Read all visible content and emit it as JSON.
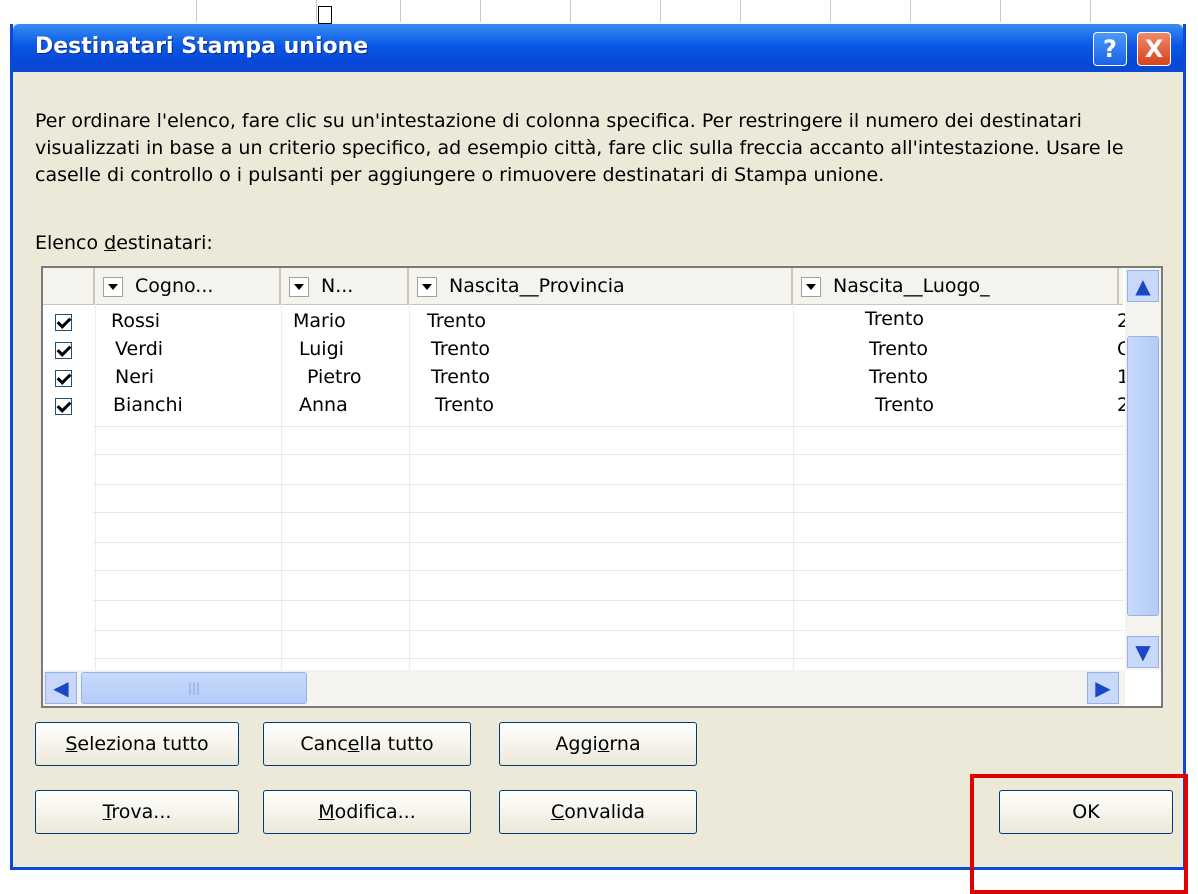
{
  "window": {
    "title": "Destinatari Stampa unione"
  },
  "title_buttons": {
    "help": "?",
    "close": "X"
  },
  "description": "Per ordinare l'elenco, fare clic su un'intestazione di colonna specifica. Per restringere il numero dei destinatari visualizzati in base a un criterio specifico, ad esempio città, fare clic sulla freccia accanto all'intestazione. Usare le caselle di controllo o i pulsanti per aggiungere o rimuovere destinatari di Stampa unione.",
  "list_label": {
    "before": "Elenco ",
    "accel": "d",
    "after": "estinatari:"
  },
  "columns": [
    "Cogno...",
    "N...",
    "Nascita__Provincia",
    "Nascita__Luogo_"
  ],
  "rows": [
    {
      "checked": true,
      "cognome": "Rossi",
      "nome": "Mario",
      "provincia": "Trento",
      "luogo": "Trento",
      "extra": "2"
    },
    {
      "checked": true,
      "cognome": "Verdi",
      "nome": "Luigi",
      "provincia": "Trento",
      "luogo": "Trento",
      "extra": "C"
    },
    {
      "checked": true,
      "cognome": "Neri",
      "nome": "Pietro",
      "provincia": "Trento",
      "luogo": "Trento",
      "extra": "1"
    },
    {
      "checked": true,
      "cognome": "Bianchi",
      "nome": "Anna",
      "provincia": "Trento",
      "luogo": "Trento",
      "extra": "2"
    }
  ],
  "buttons": {
    "select_all": {
      "accel": "S",
      "rest": "eleziona tutto"
    },
    "clear_all": {
      "before": "Canc",
      "accel": "e",
      "after": "lla tutto"
    },
    "refresh": {
      "before": "Aggi",
      "accel": "o",
      "after": "rna"
    },
    "find": {
      "accel": "T",
      "rest": "rova..."
    },
    "edit": {
      "accel": "M",
      "rest": "odifica..."
    },
    "validate": {
      "accel": "C",
      "rest": "onvalida"
    },
    "ok": "OK"
  },
  "annotation_color": "#e00000"
}
